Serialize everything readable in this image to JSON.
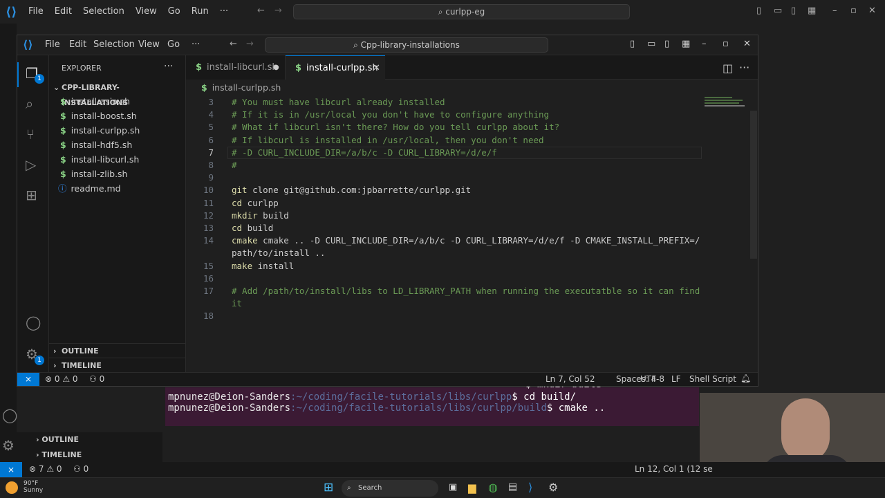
{
  "back": {
    "menu": [
      "File",
      "Edit",
      "Selection",
      "View",
      "Go",
      "Run",
      "···"
    ],
    "search": "curlpp-eg",
    "sidebar": {
      "outline": "OUTLINE",
      "timeline": "TIMELINE"
    },
    "status": {
      "errors": "7",
      "warnings": "0",
      "ports": "0",
      "position": "Ln 12, Col 1 (12 se"
    },
    "terminal": {
      "line1_cmd": "$ mkdir build",
      "line2_user": "mpnunez@Deion-Sanders",
      "line2_path": ":~/coding/facile-tutorials/libs/curlpp",
      "line2_cmd": "$ cd build/",
      "line3_user": "mpnunez@Deion-Sanders",
      "line3_path": ":~/coding/facile-tutorials/libs/curlpp/build",
      "line3_cmd": "$ cmake .."
    }
  },
  "taskbar": {
    "weather_temp": "90°F",
    "weather_desc": "Sunny",
    "search": "Search"
  },
  "window": {
    "menu": [
      "File",
      "Edit",
      "Selection",
      "View",
      "Go",
      "···"
    ],
    "search": "Cpp-library-installations",
    "explorer_title": "EXPLORER",
    "folder": "CPP-LIBRARY-INSTALLATIONS",
    "files": [
      "install-asio.sh",
      "install-boost.sh",
      "install-curlpp.sh",
      "install-hdf5.sh",
      "install-libcurl.sh",
      "install-zlib.sh",
      "readme.md"
    ],
    "outline": "OUTLINE",
    "timeline": "TIMELINE",
    "tabs": [
      {
        "label": "install-libcurl.sh",
        "state": "modified"
      },
      {
        "label": "install-curlpp.sh",
        "state": "active"
      }
    ],
    "breadcrumb": "install-curlpp.sh",
    "status": {
      "errors": "0",
      "warnings": "0",
      "ports": "0",
      "position": "Ln 7, Col 52",
      "spaces": "Spaces: 4",
      "encoding": "UTF-8",
      "eol": "LF",
      "language": "Shell Script"
    },
    "code_lines": [
      {
        "n": "3",
        "text": "# You must have libcurl already installed",
        "kind": "comment"
      },
      {
        "n": "4",
        "text": "# If it is in /usr/local you don't have to configure anything",
        "kind": "comment"
      },
      {
        "n": "5",
        "text": "# What if libcurl isn't there? How do you tell curlpp about it?",
        "kind": "comment"
      },
      {
        "n": "6",
        "text": "# If libcurl is installed in /usr/local, then you don't need",
        "kind": "comment"
      },
      {
        "n": "7",
        "text": "# -D CURL_INCLUDE_DIR=/a/b/c -D CURL_LIBRARY=/d/e/f",
        "kind": "comment"
      },
      {
        "n": "8",
        "text": "#",
        "kind": "comment"
      },
      {
        "n": "9",
        "text": "",
        "kind": "text"
      },
      {
        "n": "10",
        "cmd": "git",
        "rest": " clone git@github.com:jpbarrette/curlpp.git",
        "kind": "command"
      },
      {
        "n": "11",
        "cmd": "cd",
        "rest": " curlpp",
        "kind": "command"
      },
      {
        "n": "12",
        "cmd": "mkdir",
        "rest": " build",
        "kind": "command"
      },
      {
        "n": "13",
        "cmd": "cd",
        "rest": " build",
        "kind": "command"
      },
      {
        "n": "14",
        "cmd": "cmake",
        "rest": " cmake .. -D CURL_INCLUDE_DIR=/a/b/c -D CURL_LIBRARY=/d/e/f -D CMAKE_INSTALL_PREFIX=/",
        "cont": "path/to/install ..",
        "kind": "command"
      },
      {
        "n": "15",
        "cmd": "make",
        "rest": " install",
        "kind": "command"
      },
      {
        "n": "16",
        "text": "",
        "kind": "text"
      },
      {
        "n": "17",
        "text": "# Add /path/to/install/libs to LD_LIBRARY_PATH when running the executatble so it can find",
        "cont": "it",
        "kind": "comment"
      },
      {
        "n": "18",
        "text": "",
        "kind": "text"
      }
    ]
  },
  "colors": {
    "accent": "#0078d4",
    "comment": "#6a9955",
    "command": "#dcdcaa",
    "terminal_banner": "#3b1a34"
  }
}
